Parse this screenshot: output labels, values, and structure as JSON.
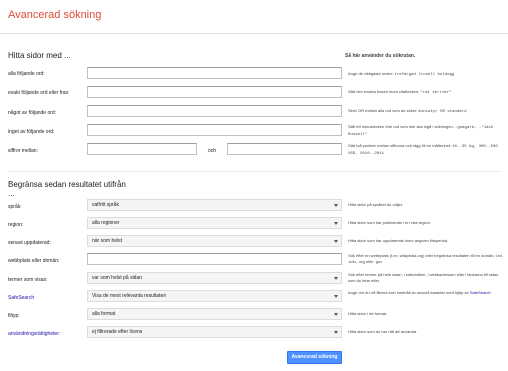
{
  "header": {
    "title": "Avancerad sökning"
  },
  "find": {
    "title": "Hitta sidor med ...",
    "help_title": "Så här använder du sökrutan.",
    "rows": [
      {
        "label": "alla följande ord:",
        "help_prefix": "Ange de viktigaste orden: ",
        "help_code": "trefärgad Jrusell buldogg",
        "help_suffix": ""
      },
      {
        "label": "exakt följande ord eller fras:",
        "help_prefix": "Sätt den exakta frasen inom citattecken: ",
        "help_code": "\"rat terrier\"",
        "help_suffix": ""
      },
      {
        "label": "något av följande ord:",
        "help_prefix": "Skriv OR mellan alla ord som du söker: ",
        "help_code": "miniatyr OR standard",
        "help_suffix": ""
      },
      {
        "label": "inget av följande ord:",
        "help_prefix": "Sätt ett minustecken före ord som inte ska ingå i sökningen: ",
        "help_code": "-gnagare, -\"Jack Russell\"",
        "help_suffix": ""
      },
      {
        "label": "siffror mellan:",
        "help_prefix": "Sätt två punkter mellan siffrorna och lägg till en måttenhet: ",
        "help_code": "10..35 kg, 300..500 USD, 2010..2011",
        "help_suffix": ""
      }
    ],
    "and_label": "och"
  },
  "narrow": {
    "title": "Begränsa sedan resultatet utifrån ...",
    "rows": [
      {
        "label": "språk:",
        "value": "valfritt språk",
        "help": "Hitta sidor på språket du väljer.",
        "link": false
      },
      {
        "label": "region:",
        "value": "alla regioner",
        "help": "Hitta sidor som har publicerats i en viss region.",
        "link": false
      },
      {
        "label": "senast uppdaterad:",
        "value": "när som helst",
        "help": "Hitta sidor som har uppdaterats inom angiven tidsperiod.",
        "link": false
      },
      {
        "label": "webbplats eller domän:",
        "value": "",
        "help": "Sök efter en webbplats (t.ex. wikipedia.org) eller begränsa resultaten till en domän, t.ex. .edu, .org eller .gov",
        "link": false
      },
      {
        "label": "termer som visas:",
        "value": "var som helst på sidan",
        "help": "Sök efter termer på hela sidan, i sidrubriken, i webbadressen eller i länkarna till sidan som du letar efter.",
        "link": false
      },
      {
        "label": "SafeSearch",
        "value": "Visa de mest relevanta resultaten",
        "help_prefix": "Ange om du vill filtrera bort innehåll av sexuell karaktär med hjälp av ",
        "help_link": "SafeSearch",
        "link": true
      },
      {
        "label": "filtyp:",
        "value": "alla format",
        "help": "Hitta sidor i ett format.",
        "link": false
      },
      {
        "label": "användningsrättigheter:",
        "value": "ej filtrerade efter licens",
        "help": "Hitta sidor som du har rätt att använda.",
        "link": true
      }
    ]
  },
  "submit_label": "Avancerad sökning"
}
